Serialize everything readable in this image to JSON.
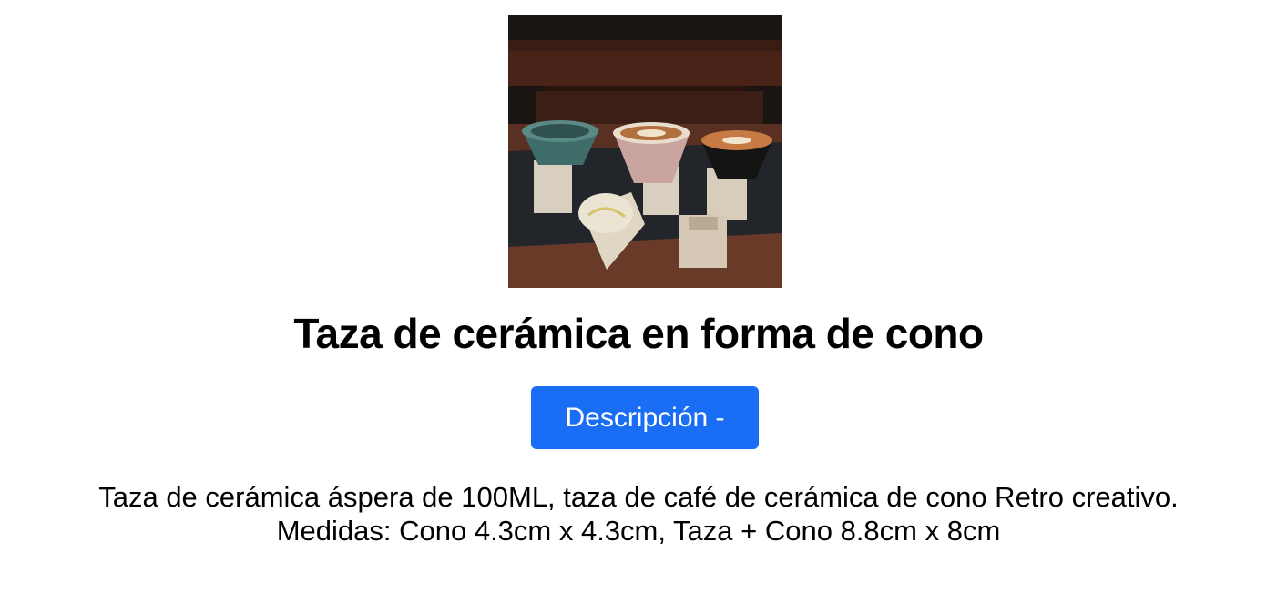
{
  "product": {
    "title": "Taza de cerámica en forma de cono",
    "description_button_label": "Descripción -",
    "description_lines": [
      "Taza de cerámica áspera de 100ML, taza de café de cerámica de cono Retro creativo.",
      "Medidas: Cono 4.3cm x 4.3cm, Taza + Cono 8.8cm x 8cm"
    ]
  },
  "colors": {
    "button_bg": "#1a6ef5",
    "button_text": "#ffffff",
    "text": "#000000"
  }
}
